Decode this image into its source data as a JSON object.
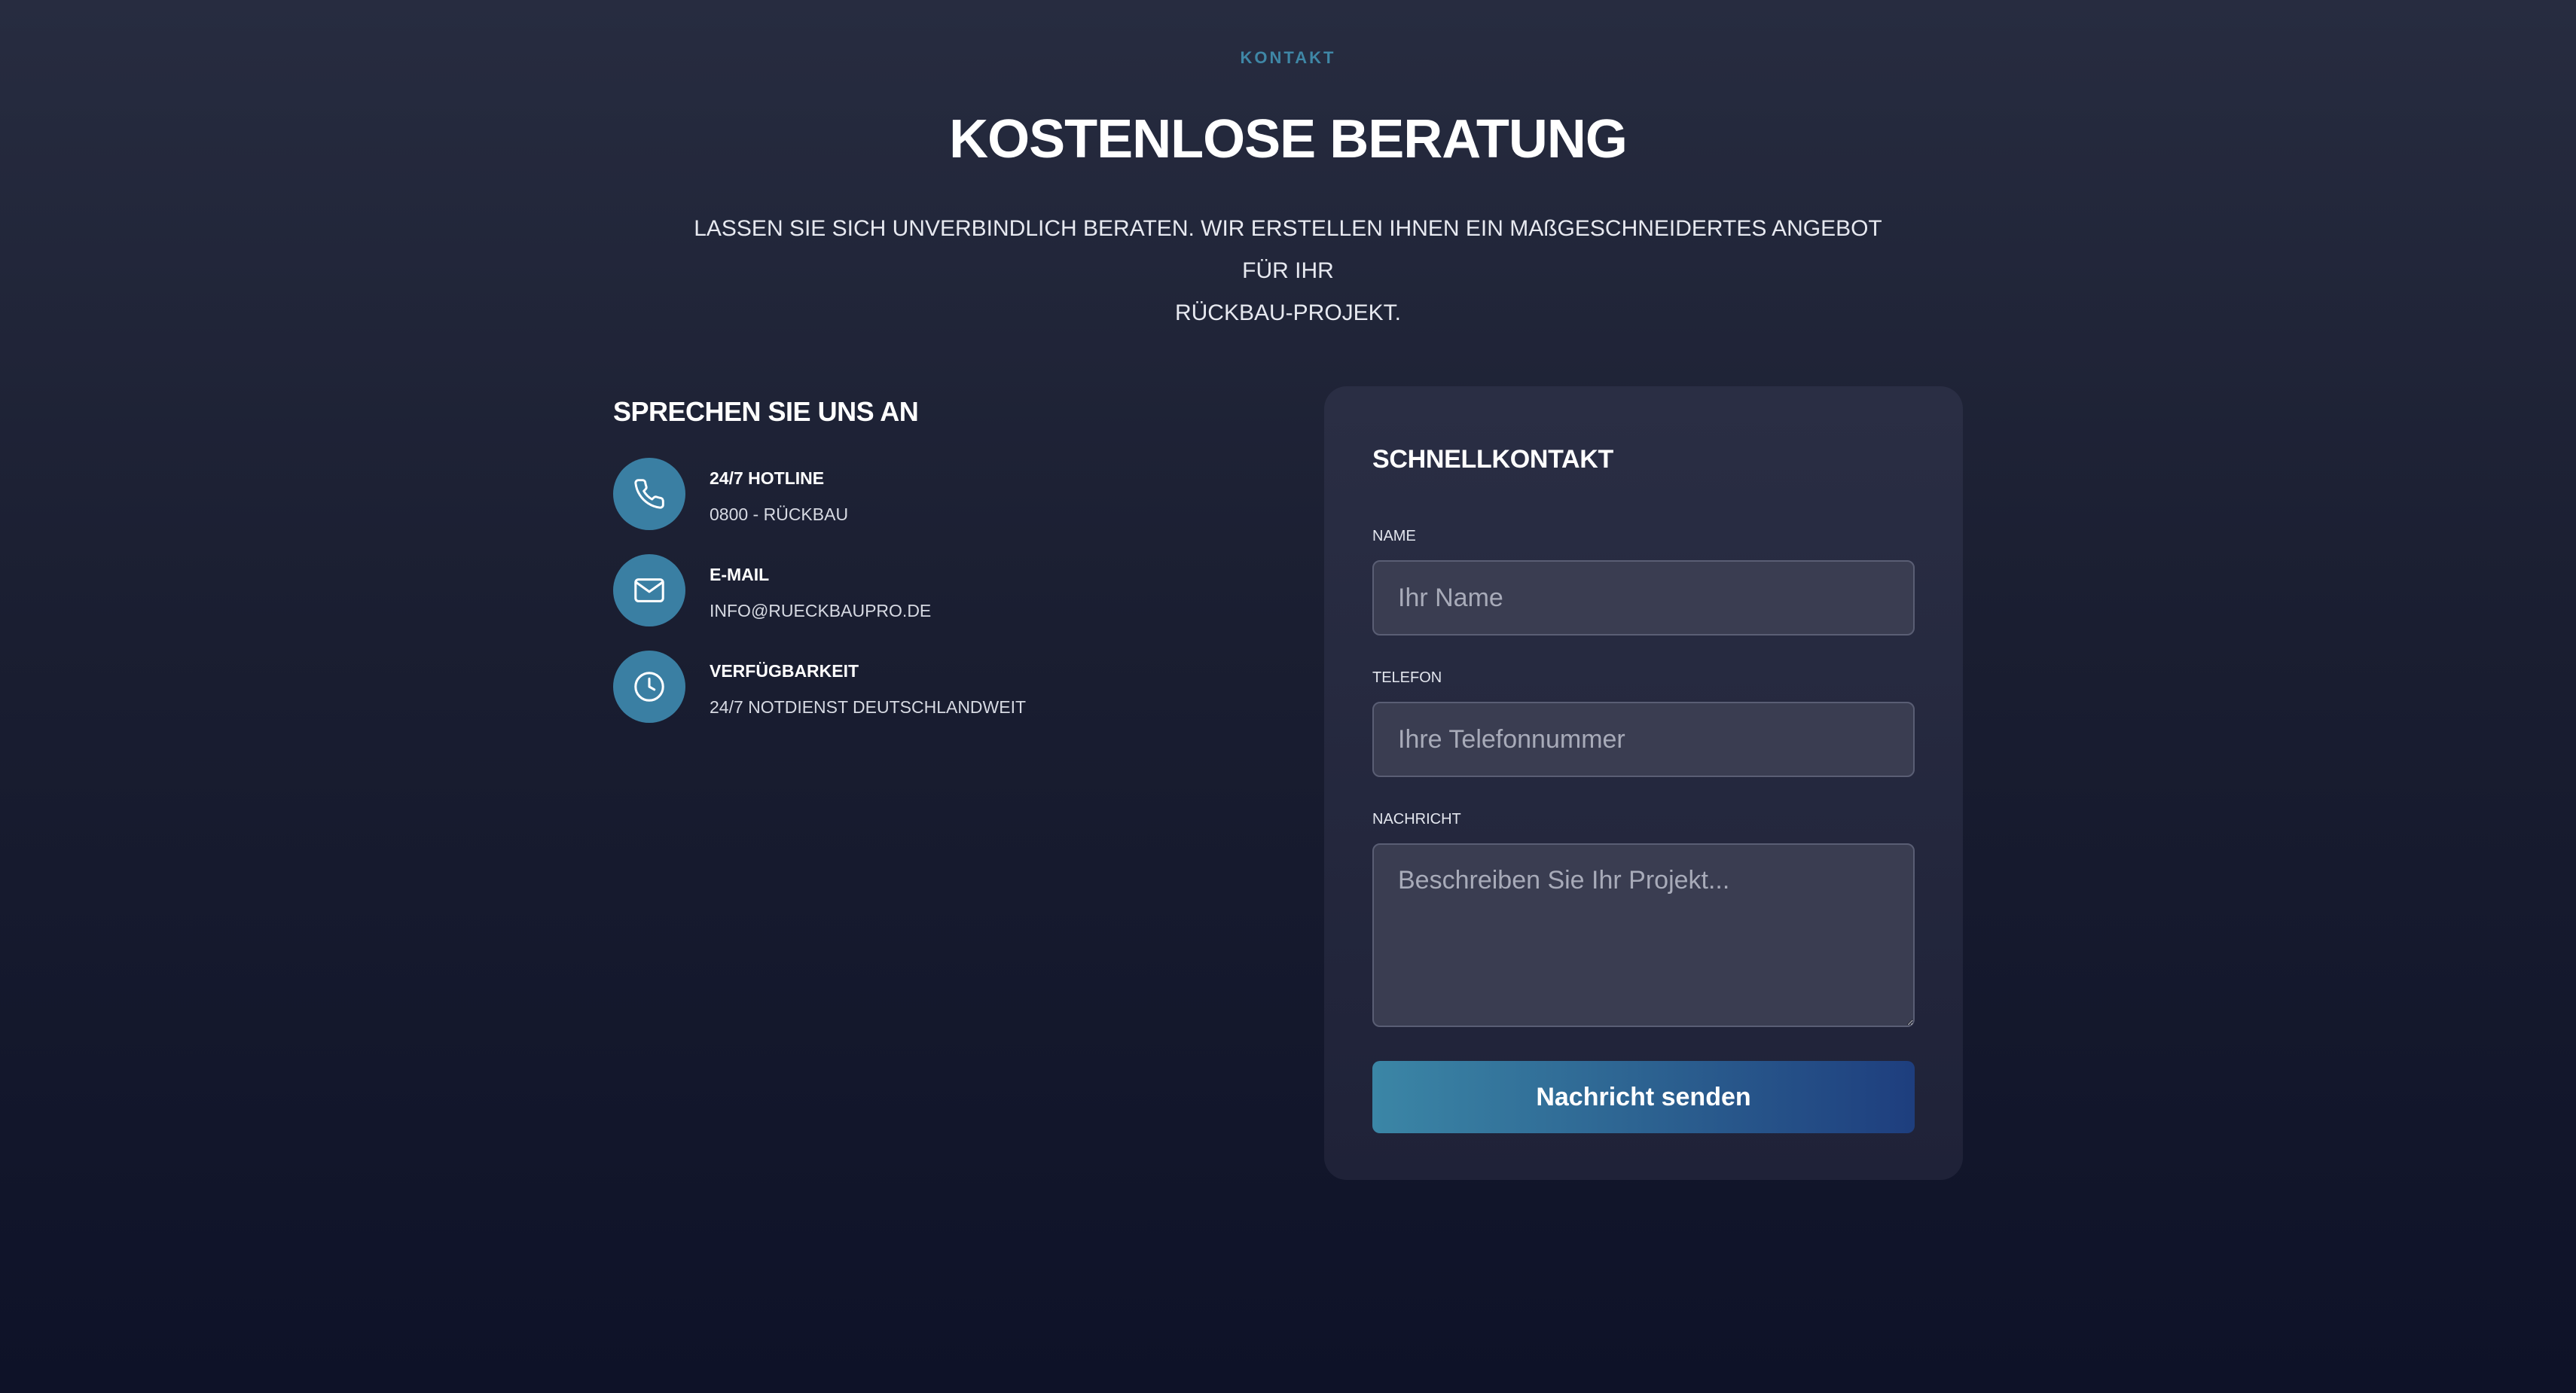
{
  "header": {
    "eyebrow": "KONTAKT",
    "title": "KOSTENLOSE BERATUNG",
    "subtitle_line1": "LASSEN SIE SICH UNVERBINDLICH BERATEN. WIR ERSTELLEN IHNEN EIN MAßGESCHNEIDERTES ANGEBOT FÜR IHR",
    "subtitle_line2": "RÜCKBAU-PROJEKT."
  },
  "contact": {
    "heading": "SPRECHEN SIE UNS AN",
    "items": [
      {
        "icon": "phone-icon",
        "label": "24/7 HOTLINE",
        "value": "0800 - RÜCKBAU"
      },
      {
        "icon": "mail-icon",
        "label": "E-MAIL",
        "value": "INFO@RUECKBAUPRO.DE"
      },
      {
        "icon": "clock-icon",
        "label": "VERFÜGBARKEIT",
        "value": "24/7 NOTDIENST DEUTSCHLANDWEIT"
      }
    ]
  },
  "form": {
    "title": "SCHNELLKONTAKT",
    "name_label": "NAME",
    "name_placeholder": "Ihr Name",
    "phone_label": "TELEFON",
    "phone_placeholder": "Ihre Telefonnummer",
    "message_label": "NACHRICHT",
    "message_placeholder": "Beschreiben Sie Ihr Projekt...",
    "submit_label": "Nachricht senden"
  },
  "colors": {
    "accent": "#3a7fa3",
    "eyebrow": "#3f87a6",
    "button_gradient_start": "#3b86a6",
    "button_gradient_end": "#1e3e7e"
  }
}
